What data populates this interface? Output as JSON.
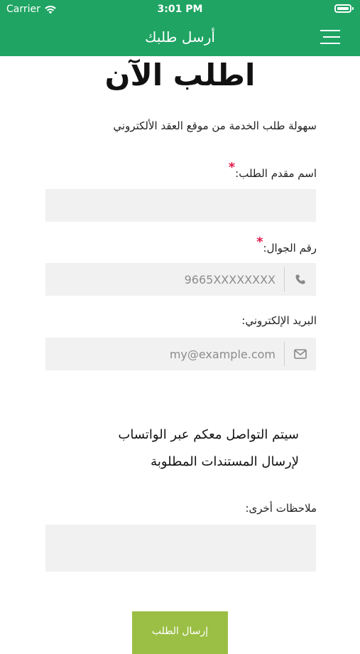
{
  "status_bar": {
    "carrier": "Carrier",
    "time": "3:01 PM"
  },
  "nav": {
    "title": "أرسل طلبك"
  },
  "page": {
    "title": "اطلب الآن",
    "intro": "سهولة طلب الخدمة من موقع العقد الألكتروني"
  },
  "form": {
    "name_label": "اسم مقدم الطلب:",
    "phone_label": "رقم الجوال:",
    "phone_placeholder": "9665XXXXXXXX",
    "email_label": "البريد الإلكتروني:",
    "email_placeholder": "my@example.com",
    "required_mark": "*",
    "whatsapp_line1": "سيتم التواصل معكم عبر الواتساب",
    "whatsapp_line2": "لإرسال المستندات المطلوبة",
    "notes_label": "ملاحظات أخرى:",
    "submit_label": "إرسال الطلب"
  },
  "colors": {
    "primary": "#1fa463",
    "submit": "#9bbf45",
    "required": "#e0194b",
    "field_bg": "#f1f1f1"
  },
  "icons": [
    "wifi-icon",
    "battery-icon",
    "menu-icon",
    "phone-icon",
    "envelope-icon"
  ]
}
